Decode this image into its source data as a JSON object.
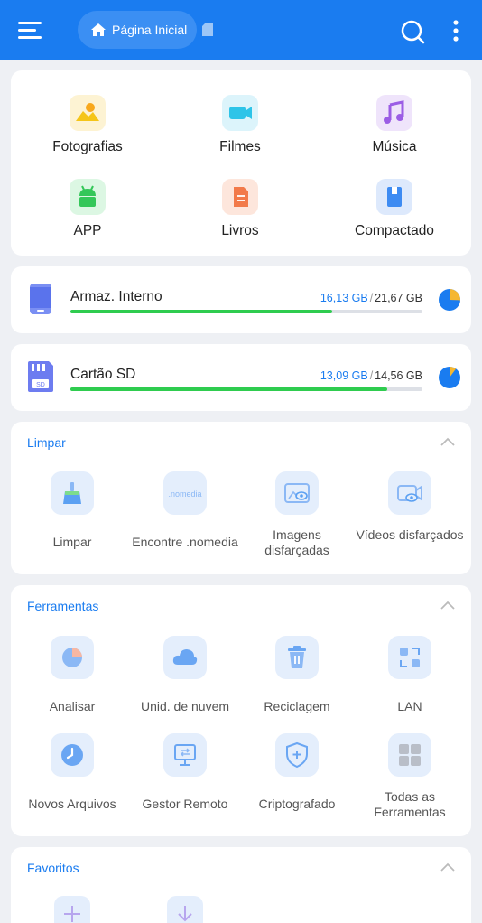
{
  "header": {
    "home_label": "Página Inicial",
    "icons": [
      "menu-icon",
      "home-icon",
      "document-icon",
      "search-icon",
      "more-vertical-icon"
    ]
  },
  "categories": [
    {
      "label": "Fotografias",
      "icon": "image-icon",
      "color": "#f5c518"
    },
    {
      "label": "Filmes",
      "icon": "video-icon",
      "color": "#2ec4e8"
    },
    {
      "label": "Música",
      "icon": "music-icon",
      "color": "#9b5de5"
    },
    {
      "label": "APP",
      "icon": "android-icon",
      "color": "#34c759"
    },
    {
      "label": "Livros",
      "icon": "book-icon",
      "color": "#f27a4a"
    },
    {
      "label": "Compactado",
      "icon": "archive-icon",
      "color": "#3d8bf2"
    }
  ],
  "storage": [
    {
      "name": "Armaz. Interno",
      "used": "16,13 GB",
      "separator": "/",
      "total": "21,67 GB",
      "fraction": 0.744,
      "icon": "phone-icon"
    },
    {
      "name": "Cartão SD",
      "used": "13,09 GB",
      "separator": "/",
      "total": "14,56 GB",
      "fraction": 0.899,
      "icon": "sd-card-icon",
      "icon_text": "SD"
    }
  ],
  "clean": {
    "title": "Limpar",
    "items": [
      {
        "label": "Limpar",
        "icon": "broom-icon"
      },
      {
        "label": "Encontre .nomedia",
        "icon": "nomedia-icon",
        "icon_text": ".nomedia"
      },
      {
        "label": "Imagens disfarçadas",
        "icon": "hidden-image-icon"
      },
      {
        "label": "Vídeos disfarçados",
        "icon": "hidden-video-icon"
      }
    ]
  },
  "tools": {
    "title": "Ferramentas",
    "items": [
      {
        "label": "Analisar",
        "icon": "pie-chart-icon"
      },
      {
        "label": "Unid. de nuvem",
        "icon": "cloud-icon"
      },
      {
        "label": "Reciclagem",
        "icon": "trash-icon"
      },
      {
        "label": "LAN",
        "icon": "lan-icon"
      },
      {
        "label": "Novos Arquivos",
        "icon": "clock-icon"
      },
      {
        "label": "Gestor Remoto",
        "icon": "monitor-icon"
      },
      {
        "label": "Criptografado",
        "icon": "shield-icon"
      },
      {
        "label": "Todas as Ferramentas",
        "icon": "grid-icon"
      }
    ]
  },
  "favorites": {
    "title": "Favoritos",
    "items": [
      {
        "icon": "plus-icon"
      },
      {
        "icon": "download-icon"
      }
    ]
  },
  "colors": {
    "primary": "#1a7cf0",
    "progress": "#2fcc4f",
    "pie_used": "#1a7cf0",
    "pie_free": "#f5b731"
  }
}
